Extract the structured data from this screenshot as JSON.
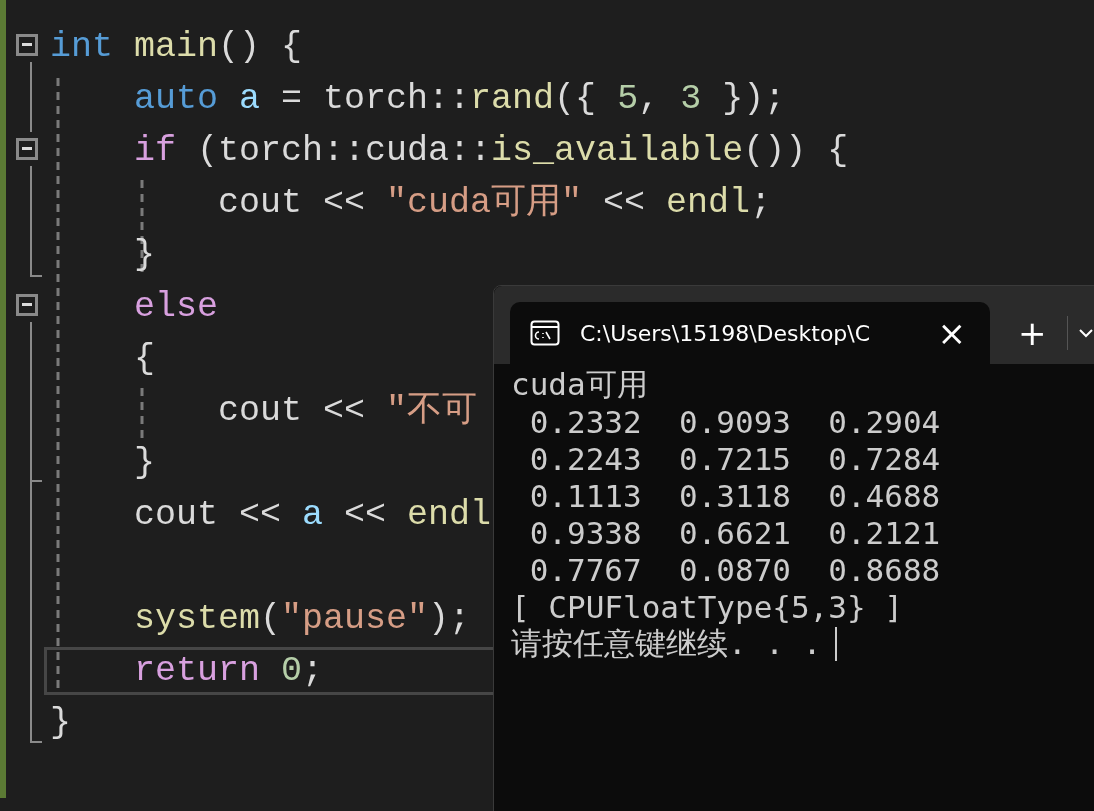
{
  "editor": {
    "lines": [
      {
        "kind": "code",
        "fold": true,
        "current": false,
        "tokens": [
          {
            "kind": "keyword",
            "text": "int"
          },
          {
            "kind": "func",
            "text": " main"
          },
          {
            "kind": "plain",
            "text": "() {"
          }
        ]
      },
      {
        "kind": "code",
        "fold": false,
        "current": false,
        "tokens": [
          {
            "kind": "keyword",
            "text": "    auto"
          },
          {
            "kind": "var",
            "text": " a"
          },
          {
            "kind": "plain",
            "text": " = torch::"
          },
          {
            "kind": "func",
            "text": "rand"
          },
          {
            "kind": "plain",
            "text": "({ "
          },
          {
            "kind": "number",
            "text": "5"
          },
          {
            "kind": "plain",
            "text": ", "
          },
          {
            "kind": "number",
            "text": "3"
          },
          {
            "kind": "plain",
            "text": " });"
          }
        ]
      },
      {
        "kind": "code",
        "fold": true,
        "current": false,
        "tokens": [
          {
            "kind": "control",
            "text": "    if"
          },
          {
            "kind": "plain",
            "text": " (torch::cuda::"
          },
          {
            "kind": "func",
            "text": "is_available"
          },
          {
            "kind": "plain",
            "text": "()) {"
          }
        ]
      },
      {
        "kind": "code",
        "fold": false,
        "current": false,
        "tokens": [
          {
            "kind": "plain",
            "text": "        cout << "
          },
          {
            "kind": "string",
            "text": "\"cuda可用\""
          },
          {
            "kind": "plain",
            "text": " << "
          },
          {
            "kind": "func",
            "text": "endl"
          },
          {
            "kind": "plain",
            "text": ";"
          }
        ]
      },
      {
        "kind": "code",
        "fold": false,
        "current": false,
        "tokens": [
          {
            "kind": "plain",
            "text": "    }"
          }
        ]
      },
      {
        "kind": "code",
        "fold": true,
        "current": false,
        "tokens": [
          {
            "kind": "control",
            "text": "    else"
          }
        ]
      },
      {
        "kind": "code",
        "fold": false,
        "current": false,
        "tokens": [
          {
            "kind": "plain",
            "text": "    {"
          }
        ]
      },
      {
        "kind": "code",
        "fold": false,
        "current": false,
        "tokens": [
          {
            "kind": "plain",
            "text": "        cout << "
          },
          {
            "kind": "string",
            "text": "\"不可"
          }
        ]
      },
      {
        "kind": "code",
        "fold": false,
        "current": false,
        "tokens": [
          {
            "kind": "plain",
            "text": "    }"
          }
        ]
      },
      {
        "kind": "code",
        "fold": false,
        "current": false,
        "tokens": [
          {
            "kind": "plain",
            "text": "    cout << "
          },
          {
            "kind": "var",
            "text": "a"
          },
          {
            "kind": "plain",
            "text": " << "
          },
          {
            "kind": "func",
            "text": "endl"
          }
        ]
      },
      {
        "kind": "blank"
      },
      {
        "kind": "code",
        "fold": false,
        "current": false,
        "tokens": [
          {
            "kind": "func",
            "text": "    system"
          },
          {
            "kind": "plain",
            "text": "("
          },
          {
            "kind": "string",
            "text": "\"pause\""
          },
          {
            "kind": "plain",
            "text": ");"
          }
        ]
      },
      {
        "kind": "code",
        "fold": false,
        "current": true,
        "tokens": [
          {
            "kind": "control",
            "text": "    return"
          },
          {
            "kind": "number",
            "text": " 0"
          },
          {
            "kind": "plain",
            "text": ";"
          }
        ]
      },
      {
        "kind": "code",
        "fold": false,
        "current": false,
        "tokens": [
          {
            "kind": "plain",
            "text": "}"
          }
        ]
      }
    ]
  },
  "terminal": {
    "tab": {
      "title": "C:\\Users\\15198\\Desktop\\C",
      "close": "×",
      "selected": true
    },
    "new_tab": "+",
    "output": [
      "cuda可用",
      " 0.2332  0.9093  0.2904",
      " 0.2243  0.7215  0.7284",
      " 0.1113  0.3118  0.4688",
      " 0.9338  0.6621  0.2121",
      " 0.7767  0.0870  0.8688",
      "[ CPUFloatType{5,3} ]",
      "请按任意键继续. . ."
    ]
  }
}
